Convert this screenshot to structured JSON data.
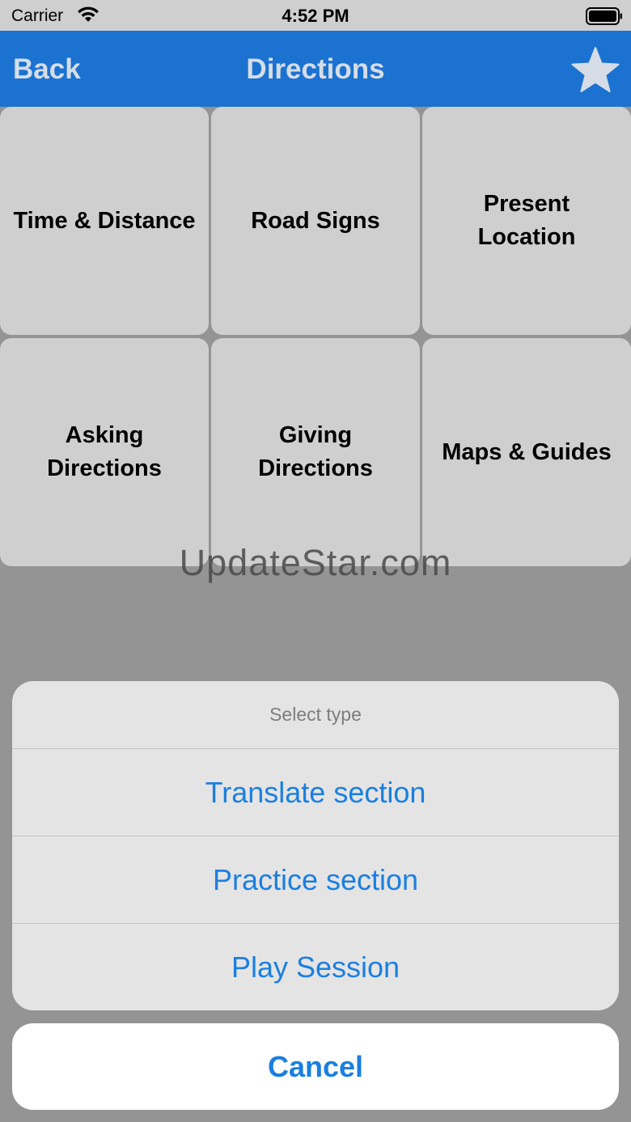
{
  "status_bar": {
    "carrier": "Carrier",
    "time": "4:52 PM",
    "icons": [
      "wifi-icon",
      "battery-icon"
    ]
  },
  "nav": {
    "back_label": "Back",
    "title": "Directions",
    "favorite_icon": "star-icon",
    "bar_color": "#1b72d1",
    "text_color": "#d6dde6"
  },
  "tiles": [
    {
      "label": "Time & Distance"
    },
    {
      "label": "Road Signs"
    },
    {
      "label": "Present Location"
    },
    {
      "label": "Asking Directions"
    },
    {
      "label": "Giving Directions"
    },
    {
      "label": "Maps & Guides"
    }
  ],
  "watermark": "UpdateStar.com",
  "action_sheet": {
    "title": "Select type",
    "options": [
      {
        "label": "Translate section"
      },
      {
        "label": "Practice section"
      },
      {
        "label": "Play Session"
      }
    ],
    "cancel_label": "Cancel",
    "accent_color": "#1a7fe0"
  }
}
